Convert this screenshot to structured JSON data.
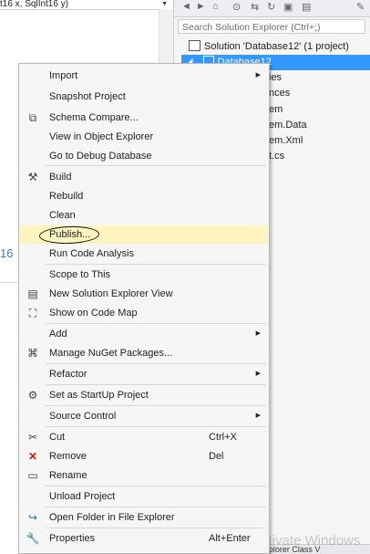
{
  "editor": {
    "code_combo_text": "t16 x, SqlInt16 y)",
    "number_fragment": "16"
  },
  "solution_explorer": {
    "search_placeholder": "Search Solution Explorer (Ctrl+;)",
    "solution_label": "Solution 'Database12' (1 project)",
    "selected_item": "Database12",
    "tree_fragments": [
      "ies",
      "nces",
      "em",
      "em.Data",
      "em.Xml",
      "t.cs"
    ],
    "bottom_tabs_text": "Solution Explor...  Team Explorer  Class V"
  },
  "watermark": "Activate Windows",
  "context_menu": {
    "highlighted_item": "Publish...",
    "items": [
      {
        "label": "Import",
        "icon": "none",
        "submenu": true
      },
      {
        "label": "Snapshot Project",
        "icon": "none"
      },
      {
        "label": "Schema Compare...",
        "icon": "schema-compare-icon"
      },
      {
        "label": "View in Object Explorer",
        "icon": "none"
      },
      {
        "label": "Go to Debug Database",
        "icon": "none"
      },
      {
        "label": "Build",
        "icon": "build-icon"
      },
      {
        "label": "Rebuild",
        "icon": "none"
      },
      {
        "label": "Clean",
        "icon": "none"
      },
      {
        "label": "Publish...",
        "icon": "none"
      },
      {
        "label": "Run Code Analysis",
        "icon": "none"
      },
      {
        "label": "Scope to This",
        "icon": "none"
      },
      {
        "label": "New Solution Explorer View",
        "icon": "new-view-icon"
      },
      {
        "label": "Show on Code Map",
        "icon": "code-map-icon"
      },
      {
        "label": "Add",
        "icon": "none",
        "submenu": true
      },
      {
        "label": "Manage NuGet Packages...",
        "icon": "nuget-icon"
      },
      {
        "label": "Refactor",
        "icon": "none",
        "submenu": true
      },
      {
        "label": "Set as StartUp Project",
        "icon": "gear-icon"
      },
      {
        "label": "Source Control",
        "icon": "none",
        "submenu": true
      },
      {
        "label": "Cut",
        "icon": "scissors-icon",
        "shortcut": "Ctrl+X"
      },
      {
        "label": "Remove",
        "icon": "remove-x-icon",
        "shortcut": "Del",
        "icon_color": "#c5201c"
      },
      {
        "label": "Rename",
        "icon": "rename-icon"
      },
      {
        "label": "Unload Project",
        "icon": "none"
      },
      {
        "label": "Open Folder in File Explorer",
        "icon": "open-folder-icon",
        "icon_color": "#1e72b4"
      },
      {
        "label": "Properties",
        "icon": "wrench-icon",
        "shortcut": "Alt+Enter"
      }
    ]
  },
  "colors": {
    "menu_background": "#f6f6f6",
    "menu_highlight": "#fdf4bf",
    "selection_blue": "#3399ff",
    "editor_number_blue": "#3d7ab8"
  }
}
